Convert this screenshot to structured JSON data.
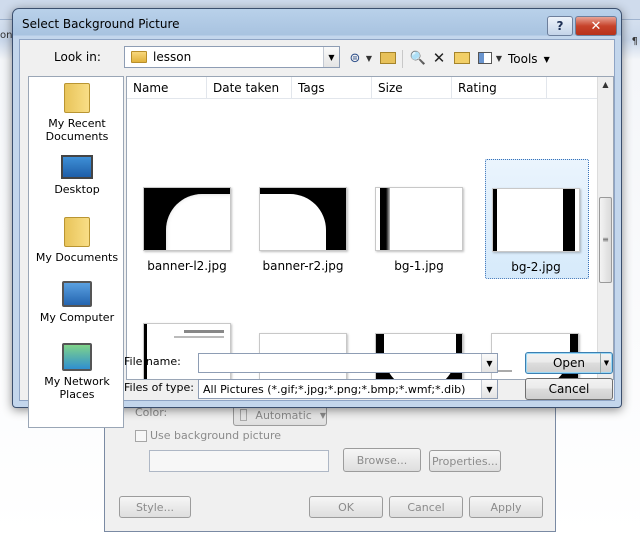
{
  "background_window": {
    "left_edge_text": "on",
    "right_edge_text": "¶",
    "dialog": {
      "color_label": "Color:",
      "color_value": "Automatic",
      "use_picture_label": "Use background picture",
      "browse_label": "Browse...",
      "properties_label": "Properties...",
      "style_label": "Style...",
      "ok_label": "OK",
      "cancel_label": "Cancel",
      "apply_label": "Apply"
    }
  },
  "dialog": {
    "title": "Select Background Picture",
    "help_label": "?",
    "close_label": "✕",
    "look_in_label": "Look in:",
    "look_in_value": "lesson",
    "tools_label": "Tools",
    "places": [
      {
        "label": "My Recent Documents",
        "icon": "recent-documents-icon"
      },
      {
        "label": "Desktop",
        "icon": "desktop-icon"
      },
      {
        "label": "My Documents",
        "icon": "my-documents-icon"
      },
      {
        "label": "My Computer",
        "icon": "my-computer-icon"
      },
      {
        "label": "My Network Places",
        "icon": "network-places-icon"
      }
    ],
    "columns": [
      "Name",
      "Date taken",
      "Tags",
      "Size",
      "Rating"
    ],
    "files": [
      {
        "name": "banner-l2.jpg",
        "selected": false
      },
      {
        "name": "banner-r2.jpg",
        "selected": false
      },
      {
        "name": "bg-1.jpg",
        "selected": false
      },
      {
        "name": "bg-2.jpg",
        "selected": true
      }
    ],
    "file_name_label": "File name:",
    "file_name_value": "",
    "files_of_type_label": "Files of type:",
    "files_of_type_value": "All Pictures (*.gif;*.jpg;*.png;*.bmp;*.wmf;*.dib)",
    "open_label": "Open",
    "cancel_label": "Cancel"
  }
}
